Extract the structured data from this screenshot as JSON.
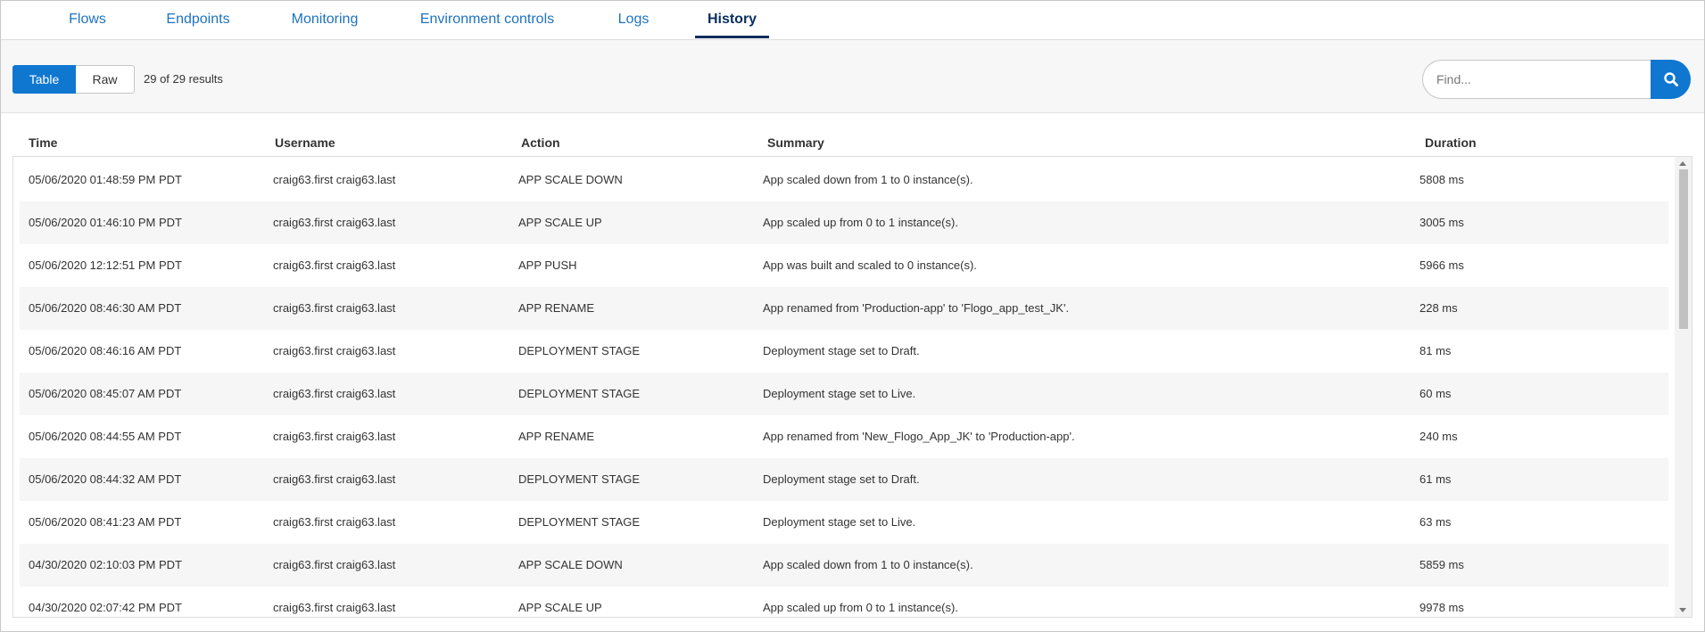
{
  "tabs": [
    {
      "label": "Flows",
      "active": false
    },
    {
      "label": "Endpoints",
      "active": false
    },
    {
      "label": "Monitoring",
      "active": false
    },
    {
      "label": "Environment controls",
      "active": false
    },
    {
      "label": "Logs",
      "active": false
    },
    {
      "label": "History",
      "active": true
    }
  ],
  "toolbar": {
    "view_table_label": "Table",
    "view_raw_label": "Raw",
    "results_text": "29 of 29 results",
    "search_placeholder": "Find...",
    "search_icon": "search-icon"
  },
  "table": {
    "columns": [
      "Time",
      "Username",
      "Action",
      "Summary",
      "Duration"
    ],
    "rows": [
      [
        "05/06/2020 01:48:59 PM PDT",
        "craig63.first craig63.last",
        "APP SCALE DOWN",
        "App scaled down from 1 to 0 instance(s).",
        "5808 ms"
      ],
      [
        "05/06/2020 01:46:10 PM PDT",
        "craig63.first craig63.last",
        "APP SCALE UP",
        "App scaled up from 0 to 1 instance(s).",
        "3005 ms"
      ],
      [
        "05/06/2020 12:12:51 PM PDT",
        "craig63.first craig63.last",
        "APP PUSH",
        "App was built and scaled to 0 instance(s).",
        "5966 ms"
      ],
      [
        "05/06/2020 08:46:30 AM PDT",
        "craig63.first craig63.last",
        "APP RENAME",
        "App renamed from 'Production-app' to 'Flogo_app_test_JK'.",
        "228 ms"
      ],
      [
        "05/06/2020 08:46:16 AM PDT",
        "craig63.first craig63.last",
        "DEPLOYMENT STAGE",
        "Deployment stage set to Draft.",
        "81 ms"
      ],
      [
        "05/06/2020 08:45:07 AM PDT",
        "craig63.first craig63.last",
        "DEPLOYMENT STAGE",
        "Deployment stage set to Live.",
        "60 ms"
      ],
      [
        "05/06/2020 08:44:55 AM PDT",
        "craig63.first craig63.last",
        "APP RENAME",
        "App renamed from 'New_Flogo_App_JK' to 'Production-app'.",
        "240 ms"
      ],
      [
        "05/06/2020 08:44:32 AM PDT",
        "craig63.first craig63.last",
        "DEPLOYMENT STAGE",
        "Deployment stage set to Draft.",
        "61 ms"
      ],
      [
        "05/06/2020 08:41:23 AM PDT",
        "craig63.first craig63.last",
        "DEPLOYMENT STAGE",
        "Deployment stage set to Live.",
        "63 ms"
      ],
      [
        "04/30/2020 02:10:03 PM PDT",
        "craig63.first craig63.last",
        "APP SCALE DOWN",
        "App scaled down from 1 to 0 instance(s).",
        "5859 ms"
      ],
      [
        "04/30/2020 02:07:42 PM PDT",
        "craig63.first craig63.last",
        "APP SCALE UP",
        "App scaled up from 0 to 1 instance(s).",
        "9978 ms"
      ]
    ]
  },
  "colors": {
    "accent": "#1077d0",
    "tab_link": "#1e72c0",
    "tab_active": "#0a2e5c"
  }
}
